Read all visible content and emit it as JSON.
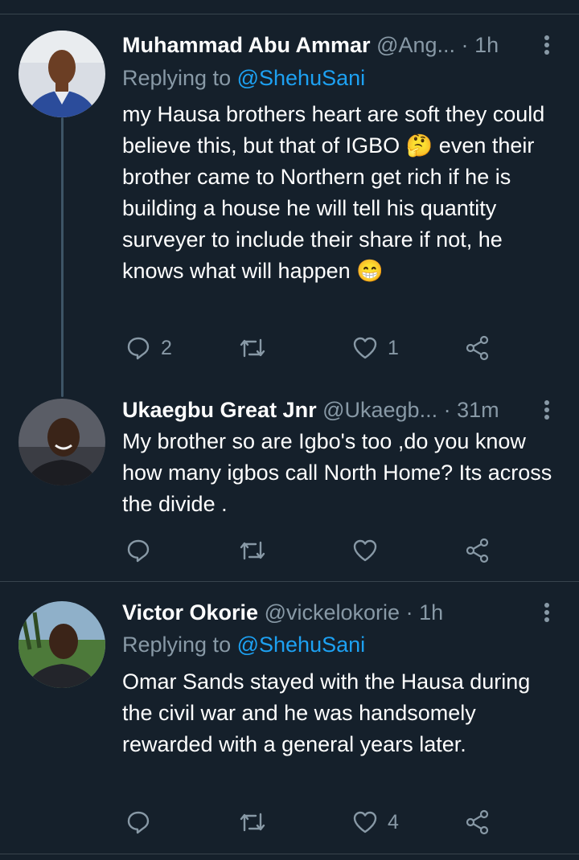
{
  "tweets": [
    {
      "name": "Muhammad Abu Ammar",
      "handle": "@Ang...",
      "time": "1h",
      "replying_label": "Replying to",
      "replying_to": "@ShehuSani",
      "text": "my Hausa brothers heart are soft they could believe this,  but that of IGBO 🤔 even their brother came to Northern get rich if he is building a house he will tell his quantity surveyer to include their share if not,  he knows what will happen 😁",
      "reply_count": "2",
      "retweet_count": "",
      "like_count": "1"
    },
    {
      "name": "Ukaegbu Great Jnr",
      "handle": "@Ukaegb...",
      "time": "31m",
      "text": "My brother so are Igbo's too ,do you know how many igbos call North Home? Its across the divide .",
      "reply_count": "",
      "retweet_count": "",
      "like_count": ""
    },
    {
      "name": "Victor Okorie",
      "handle": "@vickelokorie",
      "time": "1h",
      "replying_label": "Replying to",
      "replying_to": "@ShehuSani",
      "text": "Omar Sands stayed with the Hausa during the civil war and he was handsomely rewarded with a general years later.",
      "reply_count": "",
      "retweet_count": "",
      "like_count": "4"
    }
  ],
  "separator": "·",
  "colors": {
    "background": "#15202b",
    "muted": "#8899a6",
    "mention": "#1da1f2",
    "divider": "#38444d"
  },
  "icons": {
    "reply": "reply-icon",
    "retweet": "retweet-icon",
    "like": "heart-icon",
    "share": "share-icon",
    "menu": "more-vertical-icon"
  }
}
